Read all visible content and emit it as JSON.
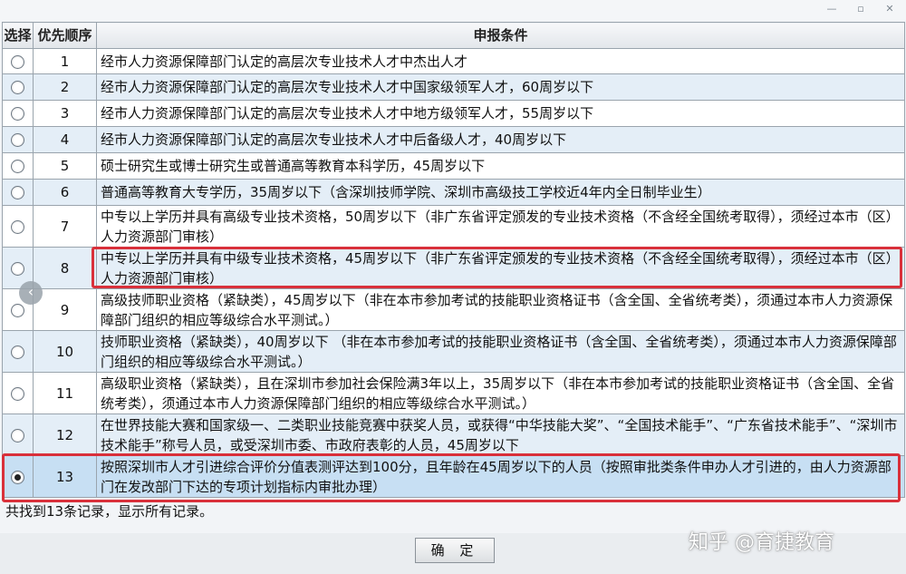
{
  "headers": {
    "select": "选择",
    "priority": "优先顺序",
    "condition": "申报条件"
  },
  "rows": [
    {
      "order": "1",
      "selected": false,
      "text": "经市人力资源保障部门认定的高层次专业技术人才中杰出人才"
    },
    {
      "order": "2",
      "selected": false,
      "text": "经市人力资源保障部门认定的高层次专业技术人才中国家级领军人才，60周岁以下"
    },
    {
      "order": "3",
      "selected": false,
      "text": "经市人力资源保障部门认定的高层次专业技术人才中地方级领军人才，55周岁以下"
    },
    {
      "order": "4",
      "selected": false,
      "text": "经市人力资源保障部门认定的高层次专业技术人才中后备级人才，40周岁以下"
    },
    {
      "order": "5",
      "selected": false,
      "text": "硕士研究生或博士研究生或普通高等教育本科学历，45周岁以下"
    },
    {
      "order": "6",
      "selected": false,
      "text": "普通高等教育大专学历，35周岁以下（含深圳技师学院、深圳市高级技工学校近4年内全日制毕业生）"
    },
    {
      "order": "7",
      "selected": false,
      "text": "中专以上学历并具有高级专业技术资格，50周岁以下（非广东省评定颁发的专业技术资格（不含经全国统考取得），须经过本市（区）人力资源部门审核）"
    },
    {
      "order": "8",
      "selected": false,
      "text": "中专以上学历并具有中级专业技术资格，45周岁以下（非广东省评定颁发的专业技术资格（不含经全国统考取得），须经过本市（区）人力资源部门审核）"
    },
    {
      "order": "9",
      "selected": false,
      "text": "高级技师职业资格（紧缺类），45周岁以下（非在本市参加考试的技能职业资格证书（含全国、全省统考类），须通过本市人力资源保障部门组织的相应等级综合水平测试。）"
    },
    {
      "order": "10",
      "selected": false,
      "text": "技师职业资格（紧缺类），40周岁以下 （非在本市参加考试的技能职业资格证书（含全国、全省统考类），须通过本市人力资源保障部门组织的相应等级综合水平测试。）"
    },
    {
      "order": "11",
      "selected": false,
      "text": "高级职业资格（紧缺类），且在深圳市参加社会保险满3年以上，35周岁以下（非在本市参加考试的技能职业资格证书（含全国、全省统考类），须通过本市人力资源保障部门组织的相应等级综合水平测试。）"
    },
    {
      "order": "12",
      "selected": false,
      "text": "在世界技能大赛和国家级一、二类职业技能竞赛中获奖人员，或获得“中华技能大奖”、“全国技术能手”、“广东省技术能手”、“深圳市技术能手”称号人员，或受深圳市委、市政府表彰的人员，45周岁以下"
    },
    {
      "order": "13",
      "selected": true,
      "text": "按照深圳市人才引进综合评价分值表测评达到100分，且年龄在45周岁以下的人员（按照审批类条件申办人才引进的，由人力资源部门在发改部门下达的专项计划指标内审批办理）"
    }
  ],
  "status": "共找到13条记录，显示所有记录。",
  "ok_label": "确 定",
  "watermark": "知乎 @育捷教育",
  "highlight_color": "#d9303a",
  "icons": {
    "scroll_left": "chevron-left-icon"
  }
}
